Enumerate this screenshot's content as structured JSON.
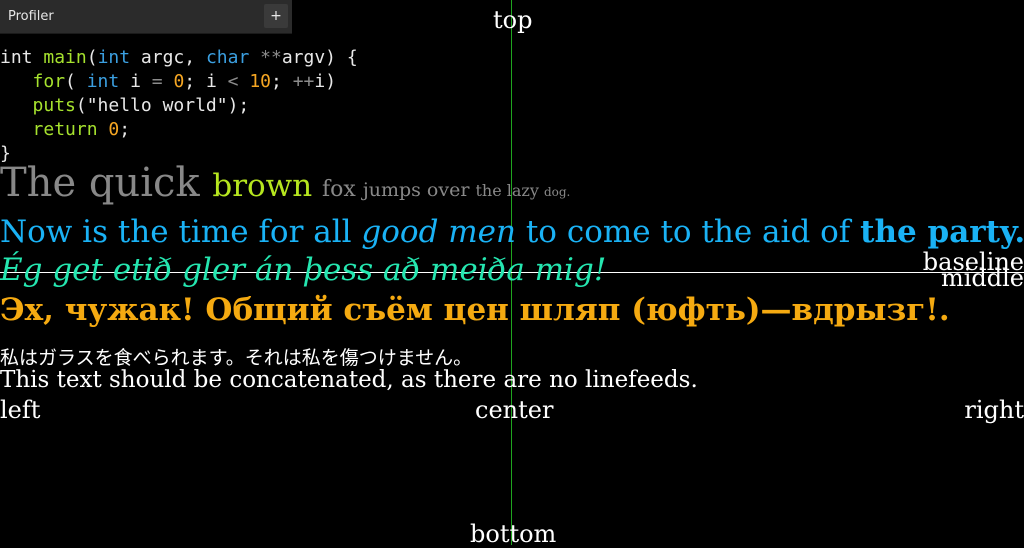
{
  "profiler": {
    "title": "Profiler",
    "add_label": "+"
  },
  "code": {
    "line1": {
      "a": "int ",
      "b": "main",
      "c": "(",
      "d": "int",
      "e": " argc, ",
      "f": "char",
      "g": " ",
      "h": "**",
      "i": "argv) {"
    },
    "line2": {
      "a": "   ",
      "b": "for",
      "c": "( ",
      "d": "int",
      "e": " i ",
      "f": "=",
      "g": " ",
      "h": "0",
      "i": "; i ",
      "j": "<",
      "k": " ",
      "l": "10",
      "m": "; ",
      "n": "++",
      "o": "i)"
    },
    "line3": {
      "a": "   ",
      "b": "puts",
      "c": "(\"hello world\");"
    },
    "line4": {
      "a": "   ",
      "b": "return",
      "c": " ",
      "d": "0",
      "e": ";"
    },
    "line5": "}"
  },
  "quick": {
    "w1": "The quick ",
    "w2": "brown ",
    "w3": "fox ",
    "w4": "jumps over ",
    "w5": "the lazy ",
    "w6": "dog."
  },
  "now": {
    "p1": "Now is the time for all ",
    "p2": "good men",
    "p3": " to come to the aid of ",
    "p4": "the party."
  },
  "icelandic": "Ég get etið gler án þess að meiða mig!",
  "russian": "Эх, чужак! Общий съём цен шляп (юфть)—вдрызг!.",
  "japanese": "私はガラスを食べられます。それは私を傷つけません。",
  "concat": "This text should be concatenated, as there are no linefeeds.",
  "labels": {
    "top": "top",
    "bottom": "bottom",
    "left": "left",
    "center": "center",
    "right": "right",
    "baseline": "baseline",
    "middle": "middle"
  },
  "colors": {
    "code_keyword": "#3b9fe0",
    "guide_vertical": "#1fa51f",
    "now_text": "#1ab2f5"
  }
}
